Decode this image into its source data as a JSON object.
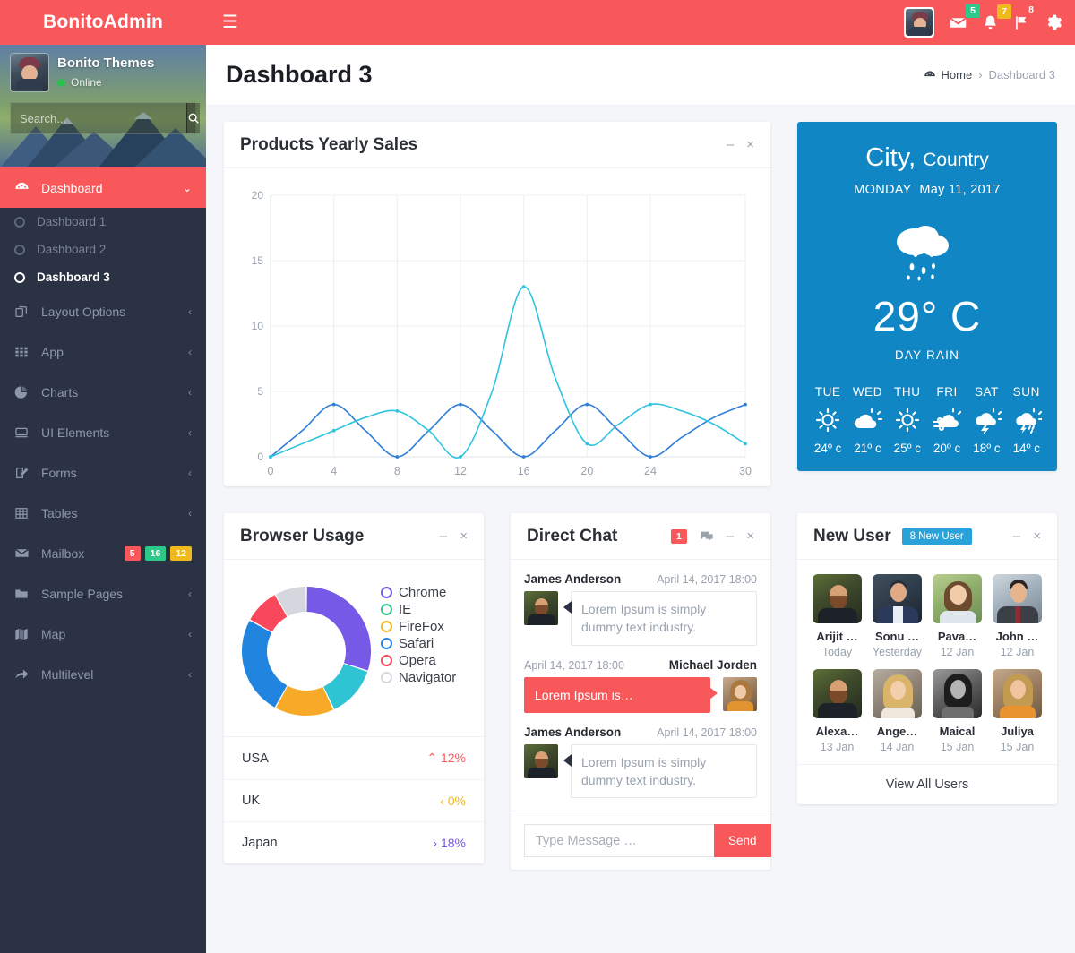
{
  "brand": {
    "title": "BonitoAdmin"
  },
  "sidebar": {
    "user": {
      "name": "Bonito Themes",
      "status": "Online"
    },
    "search": {
      "placeholder": "Search...",
      "value": ""
    },
    "menu": [
      {
        "label": "Dashboard",
        "icon": "dashboard-icon",
        "active": true,
        "chevron": "⌄"
      },
      {
        "label": "Layout Options",
        "icon": "layers-icon",
        "chevron": "‹"
      },
      {
        "label": "App",
        "icon": "grid-icon",
        "chevron": "‹"
      },
      {
        "label": "Charts",
        "icon": "pie-chart-icon",
        "chevron": "‹"
      },
      {
        "label": "UI Elements",
        "icon": "monitor-icon",
        "chevron": "‹"
      },
      {
        "label": "Forms",
        "icon": "edit-icon",
        "chevron": "‹"
      },
      {
        "label": "Tables",
        "icon": "table-icon",
        "chevron": "‹"
      },
      {
        "label": "Mailbox",
        "icon": "envelope-icon",
        "badges": [
          "5",
          "16",
          "12"
        ]
      },
      {
        "label": "Sample Pages",
        "icon": "folder-icon",
        "chevron": "‹"
      },
      {
        "label": "Map",
        "icon": "map-icon",
        "chevron": "‹"
      },
      {
        "label": "Multilevel",
        "icon": "share-icon",
        "chevron": "‹"
      }
    ],
    "submenu": [
      {
        "label": "Dashboard 1",
        "current": false
      },
      {
        "label": "Dashboard 2",
        "current": false
      },
      {
        "label": "Dashboard 3",
        "current": true
      }
    ]
  },
  "topbar": {
    "menu_toggle": "☰",
    "mail_badge": "5",
    "bell_badge": "7",
    "flag_badge": "8"
  },
  "header": {
    "title": "Dashboard 3",
    "breadcrumb": {
      "home": "Home",
      "separator": "›",
      "current": "Dashboard 3"
    }
  },
  "sales_card": {
    "title": "Products Yearly Sales",
    "minimize": "–",
    "close": "×"
  },
  "chart_data": {
    "type": "line",
    "title": "Products Yearly Sales",
    "xlabel": "",
    "ylabel": "",
    "xlim": [
      0,
      30
    ],
    "ylim": [
      0,
      20
    ],
    "xticks": [
      0,
      4,
      8,
      12,
      16,
      20,
      24,
      30
    ],
    "yticks": [
      0,
      5,
      10,
      15,
      20
    ],
    "grid": true,
    "legend": "none",
    "series": [
      {
        "name": "Series A",
        "color": "#2f7ed8",
        "x": [
          0,
          2,
          4,
          6,
          8,
          10,
          12,
          14,
          16,
          18,
          20,
          22,
          24,
          26,
          28,
          30
        ],
        "values": [
          0,
          2,
          4,
          2,
          0,
          2,
          4,
          2,
          0,
          2,
          4,
          2,
          0,
          1.5,
          3,
          4
        ]
      },
      {
        "name": "Series B",
        "color": "#2ec4e0",
        "x": [
          0,
          2,
          4,
          6,
          8,
          10,
          12,
          14,
          16,
          18,
          20,
          22,
          24,
          26,
          28,
          30
        ],
        "values": [
          0,
          1,
          2,
          3,
          3.5,
          2,
          0,
          5,
          13,
          6,
          1,
          2.5,
          4,
          3.5,
          2.5,
          1
        ]
      }
    ]
  },
  "weather": {
    "city": "City",
    "comma": ",",
    "country": "Country",
    "day": "MONDAY",
    "date": "May 11, 2017",
    "icon": "rain-cloud-icon",
    "temperature": "29° C",
    "condition": "DAY RAIN",
    "accent": "#1186c4",
    "forecast": [
      {
        "day": "TUE",
        "icon": "sun-icon",
        "temp": "24º c"
      },
      {
        "day": "WED",
        "icon": "sun-cloud-icon",
        "temp": "21º c"
      },
      {
        "day": "THU",
        "icon": "sun-icon",
        "temp": "25º c"
      },
      {
        "day": "FRI",
        "icon": "wind-cloud-icon",
        "temp": "20º c"
      },
      {
        "day": "SAT",
        "icon": "storm-icon",
        "temp": "18º c"
      },
      {
        "day": "SUN",
        "icon": "storm-rain-icon",
        "temp": "14º c"
      }
    ]
  },
  "browser": {
    "title": "Browser Usage",
    "minimize": "–",
    "close": "×",
    "chart": {
      "type": "pie",
      "title": "Browser Usage",
      "labels": [
        "Chrome",
        "IE",
        "FireFox",
        "Safari",
        "Opera",
        "Navigator"
      ],
      "values": [
        30,
        13,
        15,
        25,
        9,
        8
      ],
      "colors": [
        "#7759e8",
        "#2ec4d4",
        "#f7a928",
        "#2184df",
        "#f9485b",
        "#d4d8de"
      ]
    },
    "legend": [
      {
        "label": "Chrome",
        "color": "#7759e8"
      },
      {
        "label": "IE",
        "color": "#2ec98a"
      },
      {
        "label": "FireFox",
        "color": "#f0ba1c"
      },
      {
        "label": "Safari",
        "color": "#2184df"
      },
      {
        "label": "Opera",
        "color": "#f9485b"
      },
      {
        "label": "Navigator",
        "color": "#d4d8de"
      }
    ],
    "countries": [
      {
        "name": "USA",
        "value": "12%",
        "arrow": "⌃",
        "color": "#f9585b"
      },
      {
        "name": "UK",
        "value": "0%",
        "arrow": "‹",
        "color": "#f0ba1c"
      },
      {
        "name": "Japan",
        "value": "18%",
        "arrow": "›",
        "color": "#7759e8"
      }
    ]
  },
  "chat": {
    "title": "Direct Chat",
    "badge": "1",
    "chat_icon": "chat-bubbles-icon",
    "minimize": "–",
    "close": "×",
    "messages": [
      {
        "author": "James Anderson",
        "time": "April 14, 2017 18:00",
        "text": "Lorem Ipsum is simply dummy text industry.",
        "side": "left",
        "avatar": "av-m1"
      },
      {
        "author": "Michael Jorden",
        "time": "April 14, 2017 18:00",
        "text": "Lorem Ipsum is…",
        "side": "right",
        "avatar": "av-f1"
      },
      {
        "author": "James Anderson",
        "time": "April 14, 2017 18:00",
        "text": "Lorem Ipsum is simply dummy text industry.",
        "side": "left",
        "avatar": "av-m1"
      }
    ],
    "input_placeholder": "Type Message …",
    "input_value": "",
    "send_label": "Send"
  },
  "new_user": {
    "title": "New User",
    "badge": "8 New User",
    "minimize": "–",
    "close": "×",
    "users": [
      {
        "name": "Arijit …",
        "date": "Today",
        "art": "a-beardman"
      },
      {
        "name": "Sonu …",
        "date": "Yesterday",
        "art": "a-suitman"
      },
      {
        "name": "Pava…",
        "date": "12 Jan",
        "art": "a-flowergirl"
      },
      {
        "name": "John …",
        "date": "12 Jan",
        "art": "a-bizman"
      },
      {
        "name": "Alexa…",
        "date": "13 Jan",
        "art": "a-beardman"
      },
      {
        "name": "Ange…",
        "date": "14 Jan",
        "art": "a-blondegirl"
      },
      {
        "name": "Maical",
        "date": "15 Jan",
        "art": "a-bwgirl"
      },
      {
        "name": "Juliya",
        "date": "15 Jan",
        "art": "a-orangegirl"
      }
    ],
    "view_all": "View All Users"
  }
}
